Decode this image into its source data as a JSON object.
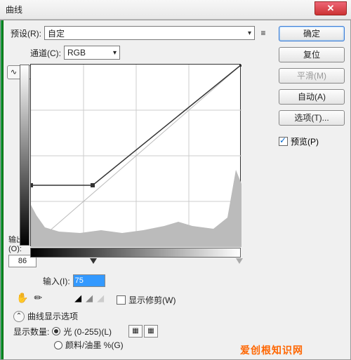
{
  "title": "曲线",
  "close_glyph": "✕",
  "preset": {
    "label": "预设(R):",
    "value": "自定"
  },
  "menu_icon": "≡",
  "channel": {
    "label": "通道(C):",
    "value": "RGB"
  },
  "tools": {
    "curve": "∿",
    "pencil": "✎"
  },
  "output": {
    "label": "输出(O):",
    "value": "86"
  },
  "input": {
    "label": "输入(I):",
    "value": "75"
  },
  "hand_icon": "✋",
  "pencil_icon": "✏",
  "eyedroppers": {
    "black": "◢",
    "gray": "◢",
    "white": "◢"
  },
  "show_clipping": {
    "label": "显示修剪(W)",
    "checked": false
  },
  "disclosure": {
    "glyph": "⌃",
    "label": "曲线显示选项"
  },
  "display_amount_label": "显示数量:",
  "radios": {
    "light": {
      "label": "光 (0-255)(L)",
      "checked": true
    },
    "pigment": {
      "label": "颜料/油墨 %(G)",
      "checked": false
    }
  },
  "grid_icons": {
    "simple": "▦",
    "detail": "▦"
  },
  "side": {
    "ok": "确定",
    "reset": "复位",
    "smooth": "平滑(M)",
    "auto": "自动(A)",
    "options": "选项(T)...",
    "preview": {
      "label": "预览(P)",
      "checked": true
    }
  },
  "watermark": "爱创根知识网",
  "chart_data": {
    "type": "line",
    "title": "曲线",
    "xlabel": "输入",
    "ylabel": "输出",
    "xlim": [
      0,
      255
    ],
    "ylim": [
      0,
      255
    ],
    "series": [
      {
        "name": "RGB",
        "points": [
          [
            0,
            86
          ],
          [
            75,
            86
          ],
          [
            255,
            255
          ]
        ]
      }
    ],
    "current_point": {
      "input": 75,
      "output": 86
    }
  }
}
